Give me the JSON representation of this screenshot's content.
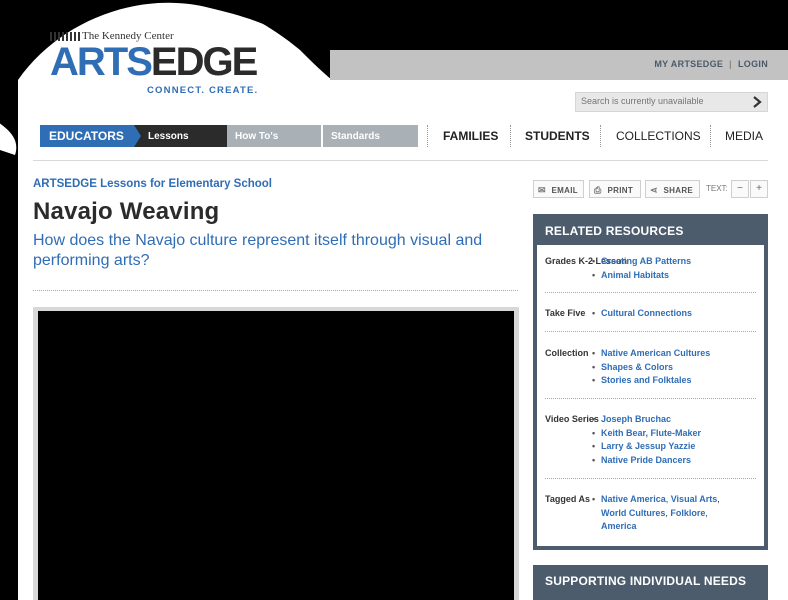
{
  "utility": {
    "my_artsedge": "MY ARTSEDGE",
    "separator": "|",
    "login": "LOGIN"
  },
  "logo": {
    "kennedy_center": "The Kennedy Center",
    "arts": "ARTS",
    "edge": "EDGE",
    "tagline": "CONNECT. CREATE."
  },
  "search": {
    "placeholder": "Search is currently unavailable",
    "icon": "chevron-right-icon"
  },
  "nav": {
    "educators": "EDUCATORS",
    "lessons": "Lessons",
    "howtos": "How To's",
    "standards": "Standards",
    "families": "FAMILIES",
    "students": "STUDENTS",
    "collections": "COLLECTIONS",
    "media": "MEDIA"
  },
  "breadcrumb": "ARTSEDGE Lessons for Elementary School",
  "title": "Navajo Weaving",
  "subtitle": "How does the Navajo culture represent itself through visual and performing arts?",
  "tools": {
    "email": "EMAIL",
    "print": "PRINT",
    "share": "SHARE",
    "text_label": "TEXT:",
    "decrease": "−",
    "increase": "+"
  },
  "related": {
    "title": "RELATED RESOURCES",
    "sections": [
      {
        "label": "Grades K-2 Lesson",
        "links": [
          "Creating AB Patterns",
          "Animal Habitats"
        ]
      },
      {
        "label": "Take Five",
        "links": [
          "Cultural Connections"
        ]
      },
      {
        "label": "Collection",
        "links": [
          "Native American Cultures",
          "Shapes & Colors",
          "Stories and Folktales"
        ]
      },
      {
        "label": "Video Series",
        "links": [
          "Joseph Bruchac",
          "Keith Bear, Flute-Maker",
          "Larry & Jessup Yazzie",
          "Native Pride Dancers"
        ]
      }
    ],
    "tagged_label": "Tagged As",
    "tags": [
      "Native America",
      "Visual Arts",
      "World Cultures",
      "Folklore",
      "America"
    ]
  },
  "supporting_title": "SUPPORTING INDIVIDUAL NEEDS",
  "colors": {
    "brand_blue": "#2f6db5",
    "panel_slate": "#4d5c6c",
    "nav_gray": "#a9b0b6"
  }
}
